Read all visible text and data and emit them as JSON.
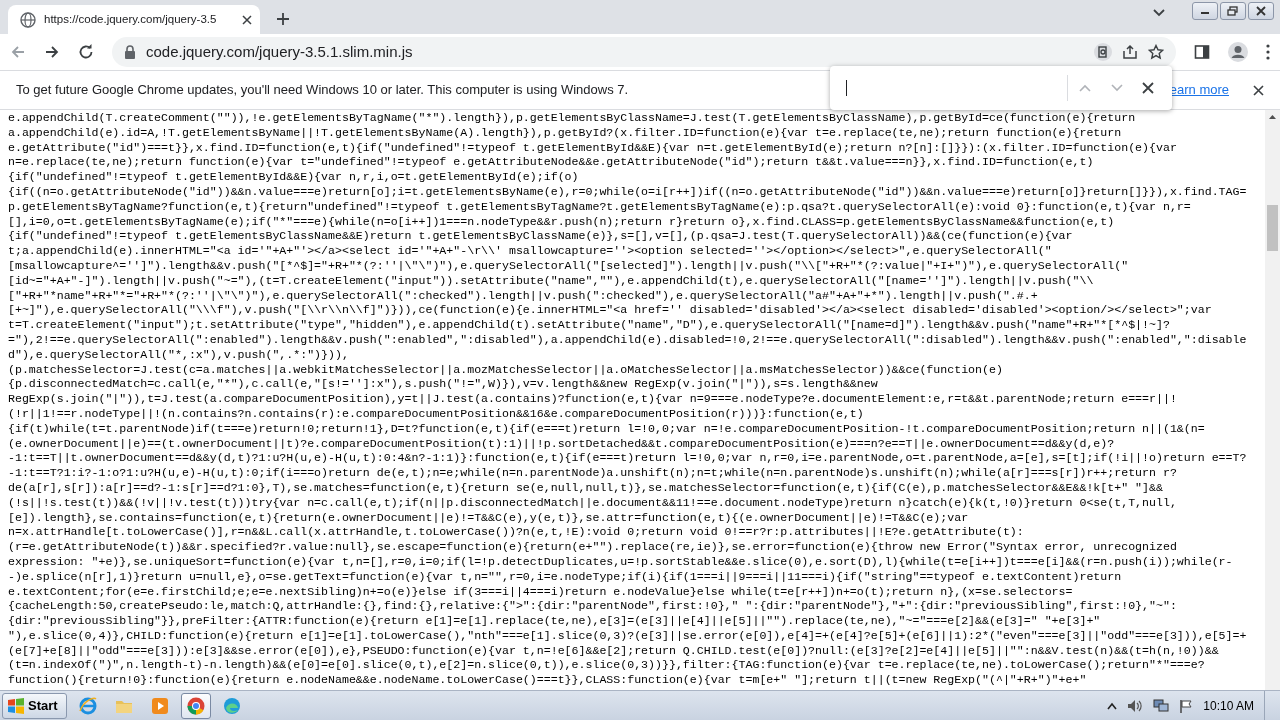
{
  "browser": {
    "tab": {
      "title": "https://code.jquery.com/jquery-3.5"
    },
    "address_bar": {
      "url": "code.jquery.com/jquery-3.5.1.slim.min.js"
    }
  },
  "info_bar": {
    "message": "To get future Google Chrome updates, you'll need Windows 10 or later. This computer is using Windows 7.",
    "link": "earn more"
  },
  "code_lines": [
    "e.appendChild(T.createComment(\"\")),!e.getElementsByTagName(\"*\").length}),p.getElementsByClassName=J.test(T.getElementsByClassName),p.getById=ce(function(e){return",
    "a.appendChild(e).id=A,!T.getElementsByName||!T.getElementsByName(A).length}),p.getById?(x.filter.ID=function(e){var t=e.replace(te,ne);return function(e){return",
    "e.getAttribute(\"id\")===t}},x.find.ID=function(e,t){if(\"undefined\"!=typeof t.getElementById&&E){var n=t.getElementById(e);return n?[n]:[]}}):(x.filter.ID=function(e){var",
    "n=e.replace(te,ne);return function(e){var t=\"undefined\"!=typeof e.getAttributeNode&&e.getAttributeNode(\"id\");return t&&t.value===n}},x.find.ID=function(e,t)",
    "{if(\"undefined\"!=typeof t.getElementById&&E){var n,r,i,o=t.getElementById(e);if(o)",
    "{if((n=o.getAttributeNode(\"id\"))&&n.value===e)return[o];i=t.getElementsByName(e),r=0;while(o=i[r++])if((n=o.getAttributeNode(\"id\"))&&n.value===e)return[o]}return[]}}),x.find.TAG=",
    "p.getElementsByTagName?function(e,t){return\"undefined\"!=typeof t.getElementsByTagName?t.getElementsByTagName(e):p.qsa?t.querySelectorAll(e):void 0}:function(e,t){var n,r=",
    "[],i=0,o=t.getElementsByTagName(e);if(\"*\"===e){while(n=o[i++])1===n.nodeType&&r.push(n);return r}return o},x.find.CLASS=p.getElementsByClassName&&function(e,t)",
    "{if(\"undefined\"!=typeof t.getElementsByClassName&&E)return t.getElementsByClassName(e)},s=[],v=[],(p.qsa=J.test(T.querySelectorAll))&&(ce(function(e){var",
    "t;a.appendChild(e).innerHTML=\"<a id='\"+A+\"'></a><select id='\"+A+\"-\\r\\\\' msallowcapture=''><option selected=''></option></select>\",e.querySelectorAll(\"",
    "[msallowcapture^='']\").length&&v.push(\"[*^$]=\"+R+\"*(?:''|\\\"\\\")\"),e.querySelectorAll(\"[selected]\").length||v.push(\"\\\\[\"+R+\"*(?:value|\"+I+\")\"),e.querySelectorAll(\"",
    "[id~=\"+A+\"-]\").length||v.push(\"~=\"),(t=T.createElement(\"input\")).setAttribute(\"name\",\"\"),e.appendChild(t),e.querySelectorAll(\"[name='']\").length||v.push(\"\\\\",
    "[\"+R+\"*name\"+R+\"*=\"+R+\"*(?:''|\\\"\\\")\"),e.querySelectorAll(\":checked\").length||v.push(\":checked\"),e.querySelectorAll(\"a#\"+A+\"+*\").length||v.push(\".#.+",
    "[+~]\"),e.querySelectorAll(\"\\\\\\f\"),v.push(\"[\\\\r\\\\n\\\\f]\")})),ce(function(e){e.innerHTML=\"<a href='' disabled='disabled'></a><select disabled='disabled'><option/></select>\";var",
    "t=T.createElement(\"input\");t.setAttribute(\"type\",\"hidden\"),e.appendChild(t).setAttribute(\"name\",\"D\"),e.querySelectorAll(\"[name=d]\").length&&v.push(\"name\"+R+\"*[*^$|!~]?",
    "=\"),2!==e.querySelectorAll(\":enabled\").length&&v.push(\":enabled\",\":disabled\"),a.appendChild(e).disabled=!0,2!==e.querySelectorAll(\":disabled\").length&&v.push(\":enabled\",\":disable",
    "d\"),e.querySelectorAll(\"*,:x\"),v.push(\",.*:\")})),",
    "(p.matchesSelector=J.test(c=a.matches||a.webkitMatchesSelector||a.mozMatchesSelector||a.oMatchesSelector||a.msMatchesSelector))&&ce(function(e)",
    "{p.disconnectedMatch=c.call(e,\"*\"),c.call(e,\"[s!='']:x\"),s.push(\"!=\",W)}),v=v.length&&new RegExp(v.join(\"|\")),s=s.length&&new",
    "RegExp(s.join(\"|\")),t=J.test(a.compareDocumentPosition),y=t||J.test(a.contains)?function(e,t){var n=9===e.nodeType?e.documentElement:e,r=t&&t.parentNode;return e===r||!",
    "(!r||1!==r.nodeType||!(n.contains?n.contains(r):e.compareDocumentPosition&&16&e.compareDocumentPosition(r)))}:function(e,t)",
    "{if(t)while(t=t.parentNode)if(t===e)return!0;return!1},D=t?function(e,t){if(e===t)return l=!0,0;var n=!e.compareDocumentPosition-!t.compareDocumentPosition;return n||(1&(n=",
    "(e.ownerDocument||e)==(t.ownerDocument||t)?e.compareDocumentPosition(t):1)||!p.sortDetached&&t.compareDocumentPosition(e)===n?e==T||e.ownerDocument==d&&y(d,e)?",
    "-1:t==T||t.ownerDocument==d&&y(d,t)?1:u?H(u,e)-H(u,t):0:4&n?-1:1)}:function(e,t){if(e===t)return l=!0,0;var n,r=0,i=e.parentNode,o=t.parentNode,a=[e],s=[t];if(!i||!o)return e==T?",
    "-1:t==T?1:i?-1:o?1:u?H(u,e)-H(u,t):0;if(i===o)return de(e,t);n=e;while(n=n.parentNode)a.unshift(n);n=t;while(n=n.parentNode)s.unshift(n);while(a[r]===s[r])r++;return r?",
    "de(a[r],s[r]):a[r]==d?-1:s[r]==d?1:0},T),se.matches=function(e,t){return se(e,null,null,t)},se.matchesSelector=function(e,t){if(C(e),p.matchesSelector&&E&&!k[t+\" \"]&&",
    "(!s||!s.test(t))&&(!v||!v.test(t)))try{var n=c.call(e,t);if(n||p.disconnectedMatch||e.document&&11!==e.document.nodeType)return n}catch(e){k(t,!0)}return 0<se(t,T,null,",
    "[e]).length},se.contains=function(e,t){return(e.ownerDocument||e)!=T&&C(e),y(e,t)},se.attr=function(e,t){(e.ownerDocument||e)!=T&&C(e);var",
    "n=x.attrHandle[t.toLowerCase()],r=n&&L.call(x.attrHandle,t.toLowerCase())?n(e,t,!E):void 0;return void 0!==r?r:p.attributes||!E?e.getAttribute(t):",
    "(r=e.getAttributeNode(t))&&r.specified?r.value:null},se.escape=function(e){return(e+\"\").replace(re,ie)},se.error=function(e){throw new Error(\"Syntax error, unrecognized",
    "expression: \"+e)},se.uniqueSort=function(e){var t,n=[],r=0,i=0;if(l=!p.detectDuplicates,u=!p.sortStable&&e.slice(0),e.sort(D),l){while(t=e[i++])t===e[i]&&(r=n.push(i));while(r-",
    "-)e.splice(n[r],1)}return u=null,e},o=se.getText=function(e){var t,n=\"\",r=0,i=e.nodeType;if(i){if(1===i||9===i||11===i){if(\"string\"==typeof e.textContent)return",
    "e.textContent;for(e=e.firstChild;e;e=e.nextSibling)n+=o(e)}else if(3===i||4===i)return e.nodeValue}else while(t=e[r++])n+=o(t);return n},(x=se.selectors=",
    "{cacheLength:50,createPseudo:le,match:Q,attrHandle:{},find:{},relative:{\">\":{dir:\"parentNode\",first:!0},\" \":{dir:\"parentNode\"},\"+\":{dir:\"previousSibling\",first:!0},\"~\":",
    "{dir:\"previousSibling\"}},preFilter:{ATTR:function(e){return e[1]=e[1].replace(te,ne),e[3]=(e[3]||e[4]||e[5]||\"\").replace(te,ne),\"~=\"===e[2]&&(e[3]=\" \"+e[3]+\"",
    "\"),e.slice(0,4)},CHILD:function(e){return e[1]=e[1].toLowerCase(),\"nth\"===e[1].slice(0,3)?(e[3]||se.error(e[0]),e[4]=+(e[4]?e[5]+(e[6]||1):2*(\"even\"===e[3]||\"odd\"===e[3])),e[5]=+",
    "(e[7]+e[8]||\"odd\"===e[3])):e[3]&&se.error(e[0]),e},PSEUDO:function(e){var t,n=!e[6]&&e[2];return Q.CHILD.test(e[0])?null:(e[3]?e[2]=e[4]||e[5]||\"\":n&&V.test(n)&&(t=h(n,!0))&&",
    "(t=n.indexOf(\")\",n.length-t)-n.length)&&(e[0]=e[0].slice(0,t),e[2]=n.slice(0,t)),e.slice(0,3))}},filter:{TAG:function(e){var t=e.replace(te,ne).toLowerCase();return\"*\"===e?",
    "function(){return!0}:function(e){return e.nodeName&&e.nodeName.toLowerCase()===t}},CLASS:function(e){var t=m[e+\" \"];return t||(t=new RegExp(\"(^|\"+R+\")\"+e+\""
  ],
  "taskbar": {
    "start": "Start",
    "apps": [
      {
        "kind": "ie",
        "selected": false
      },
      {
        "kind": "folder",
        "selected": false
      },
      {
        "kind": "media",
        "selected": false
      },
      {
        "kind": "chrome",
        "selected": true
      },
      {
        "kind": "edge",
        "selected": false
      }
    ],
    "clock": "10:10 AM"
  }
}
